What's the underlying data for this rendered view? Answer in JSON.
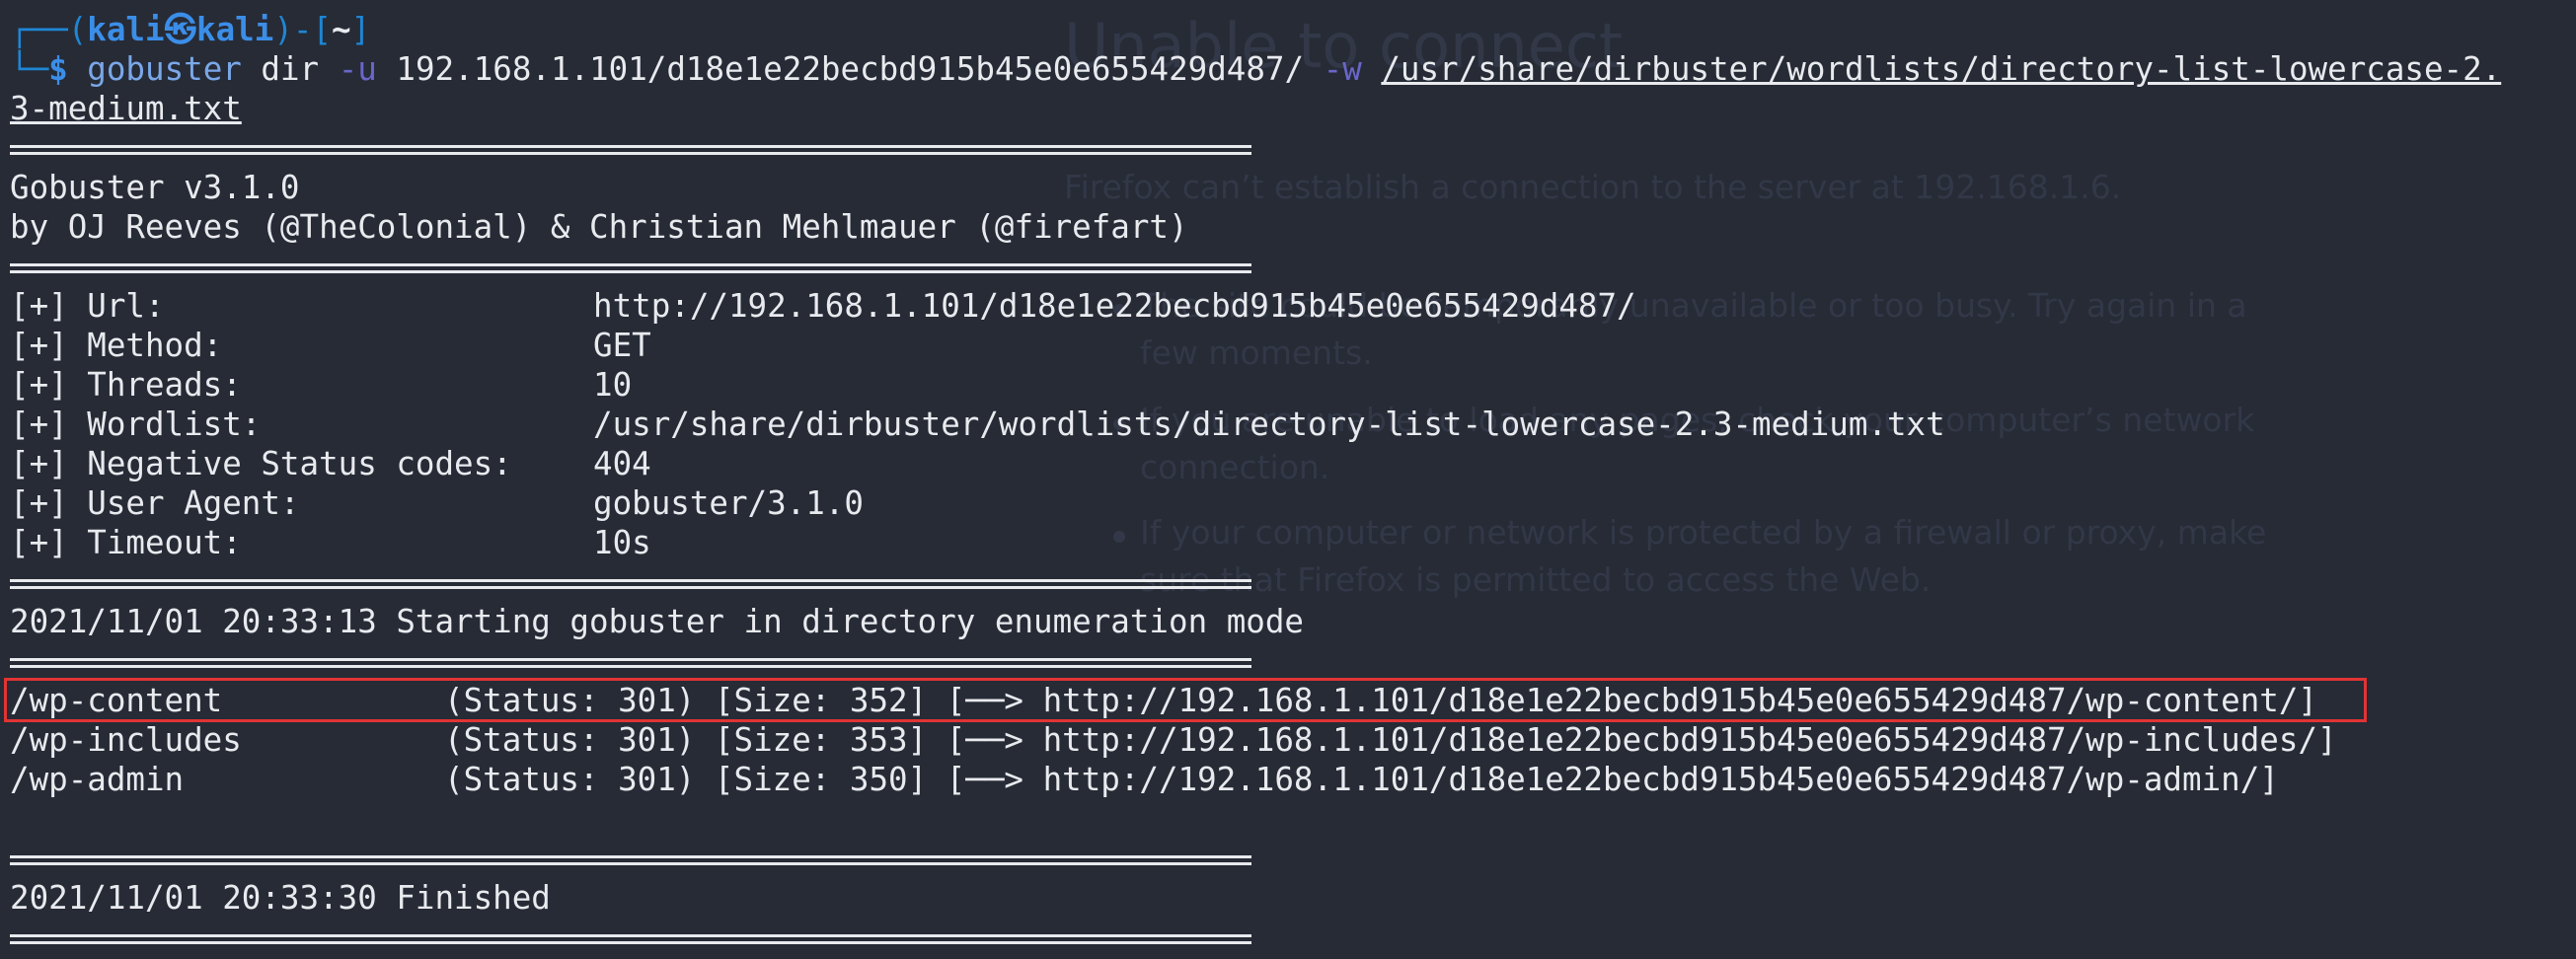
{
  "background_page": {
    "title": "Unable to connect",
    "description": "Firefox can’t establish a connection to the server at 192.168.1.6.",
    "bullet_1_line_1": "The site could be temporarily unavailable or too busy. Try again in a",
    "bullet_1_line_2": "few moments.",
    "bullet_2_line_1": "If you are unable to load any pages, check your computer’s network",
    "bullet_2_line_2": "connection.",
    "bullet_3_line_1": "If your computer or network is protected by a firewall or proxy, make",
    "bullet_3_line_2": "sure that Firefox is permitted to access the Web."
  },
  "prompt": {
    "frame_open": "┌──(",
    "user_host": "kali㉿kali",
    "frame_mid": ")-[",
    "cwd": "~",
    "frame_close": "]",
    "corner": "└─",
    "dollar": "$"
  },
  "command": {
    "program": "gobuster",
    "subcommand": "dir",
    "url_flag": "-u",
    "url_value": "192.168.1.101/d18e1e22becbd915b45e0e655429d487/",
    "wordlist_flag": "-w",
    "wordlist_part1": "/usr/share/dirbuster/wordlists/directory-list-lowercase-2.",
    "wordlist_part2": "3-medium.txt"
  },
  "banner": {
    "version": "Gobuster v3.1.0",
    "authors": "by OJ Reeves (@TheColonial) & Christian Mehlmauer (@firefart)"
  },
  "config": [
    {
      "key": "[+] Url:",
      "value": "http://192.168.1.101/d18e1e22becbd915b45e0e655429d487/"
    },
    {
      "key": "[+] Method:",
      "value": "GET"
    },
    {
      "key": "[+] Threads:",
      "value": "10"
    },
    {
      "key": "[+] Wordlist:",
      "value": "/usr/share/dirbuster/wordlists/directory-list-lowercase-2.3-medium.txt"
    },
    {
      "key": "[+] Negative Status codes:",
      "value": "404"
    },
    {
      "key": "[+] User Agent:",
      "value": "gobuster/3.1.0"
    },
    {
      "key": "[+] Timeout:",
      "value": "10s"
    }
  ],
  "start_message": "2021/11/01 20:33:13 Starting gobuster in directory enumeration mode",
  "results": [
    {
      "path": "/wp-content",
      "info": "(Status: 301) [Size: 352] [──> http://192.168.1.101/d18e1e22becbd915b45e0e655429d487/wp-content/]"
    },
    {
      "path": "/wp-includes",
      "info": "(Status: 301) [Size: 353] [──> http://192.168.1.101/d18e1e22becbd915b45e0e655429d487/wp-includes/]"
    },
    {
      "path": "/wp-admin",
      "info": "(Status: 301) [Size: 350] [──> http://192.168.1.101/d18e1e22becbd915b45e0e655429d487/wp-admin/]"
    }
  ],
  "finish_message": "2021/11/01 20:33:30 Finished",
  "colors": {
    "background": "#262b36",
    "text": "#e8eaee",
    "prompt": "#3b8ee8",
    "flag": "#6a66c9",
    "highlight": "#e03434"
  }
}
